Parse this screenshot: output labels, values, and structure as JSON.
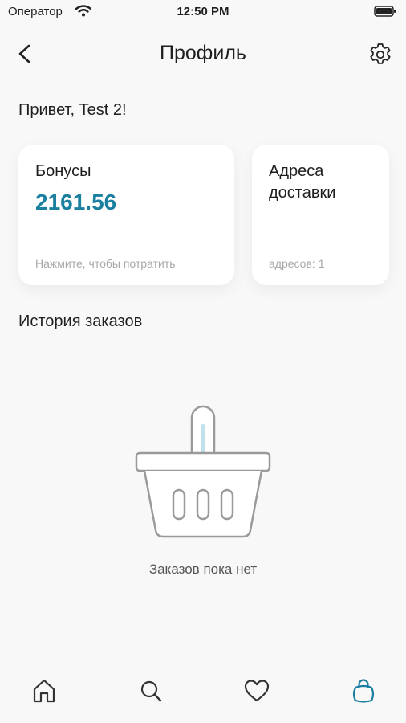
{
  "status_bar": {
    "carrier": "Оператор",
    "time": "12:50 PM"
  },
  "nav": {
    "title": "Профиль"
  },
  "greeting": "Привет, Test 2!",
  "cards": {
    "bonus": {
      "title": "Бонусы",
      "value": "2161.56",
      "hint": "Нажмите, чтобы потратить"
    },
    "addresses": {
      "title": "Адреса доставки",
      "hint": "адресов: 1"
    }
  },
  "orders": {
    "title": "История заказов",
    "empty_text": "Заказов пока нет"
  },
  "tabbar": {
    "items": [
      {
        "icon": "home-icon",
        "active": false
      },
      {
        "icon": "search-icon",
        "active": false
      },
      {
        "icon": "heart-icon",
        "active": false
      },
      {
        "icon": "bag-icon",
        "active": true
      }
    ]
  },
  "colors": {
    "accent": "#1b7fa0",
    "background": "#f8f8f8",
    "muted": "#a8a8a8"
  }
}
